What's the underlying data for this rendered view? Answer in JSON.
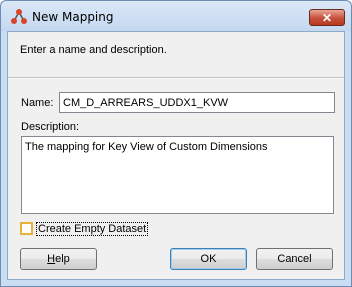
{
  "window": {
    "title": "New Mapping",
    "close_glyph": "✕"
  },
  "header": {
    "instruction": "Enter a name and description."
  },
  "form": {
    "name_label": "Name:",
    "name_value": "CM_D_ARREARS_UDDX1_KVW",
    "description_label": "Description:",
    "description_value": "The mapping for Key View of Custom Dimensions",
    "create_empty_dataset_label": "Create Empty Dataset",
    "create_empty_dataset_checked": false
  },
  "buttons": {
    "help_mnemonic": "H",
    "help_rest": "elp",
    "ok": "OK",
    "cancel": "Cancel"
  },
  "colors": {
    "titlebar": "#c9ddf3",
    "close": "#c7503b",
    "checkbox_focus": "#e8b13a",
    "ok_focus": "#3c7fb1"
  },
  "icons": {
    "app": "mapping-icon",
    "close": "close-icon"
  }
}
